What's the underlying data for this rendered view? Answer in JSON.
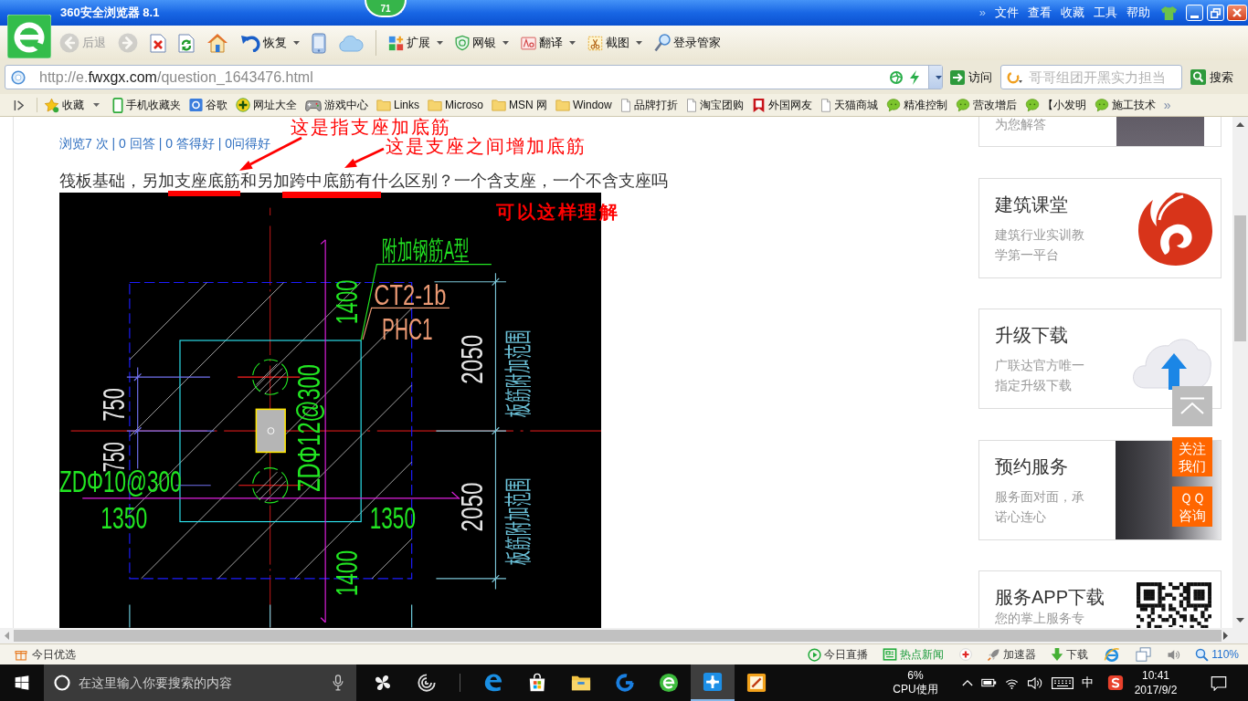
{
  "title_bar": {
    "title": "360安全浏览器 8.1",
    "badge": "71",
    "more": "»",
    "menu": [
      "文件",
      "查看",
      "收藏",
      "工具",
      "帮助"
    ]
  },
  "toolbar": {
    "nav": [
      {
        "kind": "back",
        "label": "后退",
        "disabled": true,
        "dropdown": false
      },
      {
        "kind": "forward",
        "disabled": true,
        "dropdown": false
      },
      {
        "kind": "stop",
        "disabled": false,
        "dropdown": false
      },
      {
        "kind": "refresh",
        "disabled": false,
        "dropdown": false
      },
      {
        "kind": "home",
        "disabled": false,
        "dropdown": false
      },
      {
        "kind": "restore",
        "label": "恢复",
        "disabled": false,
        "dropdown": true
      },
      {
        "kind": "phone",
        "disabled": false,
        "dropdown": false
      },
      {
        "kind": "cloud",
        "disabled": false,
        "dropdown": false
      }
    ],
    "tools": [
      {
        "kind": "extensions",
        "label": "扩展",
        "dropdown": true
      },
      {
        "kind": "bank",
        "label": "网银",
        "dropdown": true
      },
      {
        "kind": "translate",
        "label": "翻译",
        "dropdown": true
      },
      {
        "kind": "screenshot",
        "label": "截图",
        "dropdown": true
      },
      {
        "kind": "login",
        "label": "登录管家",
        "dropdown": false
      }
    ]
  },
  "address_bar": {
    "url": {
      "start": "http://e.",
      "domain": "fwxgx.com",
      "path": "/question_1643476.html"
    },
    "go_button": "访问",
    "search": {
      "placeholder": "哥哥组团开黑实力担当",
      "button": "搜索"
    }
  },
  "bookmarks": {
    "items": [
      {
        "kind": "star",
        "label": "收藏",
        "dropdown": true
      },
      {
        "kind": "mobile",
        "label": "手机收藏夹",
        "dropdown": false
      },
      {
        "kind": "tile",
        "label": "谷歌",
        "dropdown": false
      },
      {
        "kind": "plus",
        "label": "网址大全",
        "dropdown": false
      },
      {
        "kind": "gamepad",
        "label": "游戏中心",
        "dropdown": false
      },
      {
        "kind": "folder",
        "label": "Links",
        "dropdown": false
      },
      {
        "kind": "folder",
        "label": "Microso",
        "dropdown": false
      },
      {
        "kind": "folder",
        "label": "MSN 网",
        "dropdown": false
      },
      {
        "kind": "folder",
        "label": "Window",
        "dropdown": false
      },
      {
        "kind": "page",
        "label": "品牌打折",
        "dropdown": false
      },
      {
        "kind": "page",
        "label": "淘宝团购",
        "dropdown": false
      },
      {
        "kind": "flag",
        "label": "外国网友",
        "dropdown": false
      },
      {
        "kind": "page",
        "label": "天猫商城",
        "dropdown": false
      },
      {
        "kind": "chat",
        "label": "精准控制",
        "dropdown": false
      },
      {
        "kind": "chat",
        "label": "营改增后",
        "dropdown": false
      },
      {
        "kind": "chat",
        "label": "【小发明",
        "dropdown": false
      },
      {
        "kind": "chat",
        "label": "施工技术",
        "dropdown": false
      }
    ],
    "more": "»"
  },
  "page": {
    "stats": "浏览7 次 | 0 回答 | 0 答得好 | 0问得好",
    "question": "筏板基础，另加支座底筋和另加跨中底筋有什么区别？一个含支座，一个不含支座吗",
    "annotations": [
      {
        "kind": "callout",
        "text": "这是指支座加底筋"
      },
      {
        "kind": "callout",
        "text": "这是支座之间增加底筋"
      },
      {
        "kind": "note",
        "text": "可以这样理解"
      }
    ],
    "drawing": {
      "labels": [
        {
          "kind": "rebar",
          "text": "附加钢筋A型"
        },
        {
          "kind": "rebar",
          "text": "1400"
        },
        {
          "kind": "pile",
          "text": "CT2-1b"
        },
        {
          "kind": "pile",
          "text": "PHC1"
        },
        {
          "kind": "dimension",
          "text": "2050"
        },
        {
          "kind": "range",
          "text": "板筋附加范围"
        },
        {
          "kind": "dimension",
          "text": "750"
        },
        {
          "kind": "rebar",
          "text": "ZDΦ12@300"
        },
        {
          "kind": "dimension",
          "text": "750"
        },
        {
          "kind": "rebar",
          "text": "ZDΦ10@300"
        },
        {
          "kind": "dimension",
          "text": "2050"
        },
        {
          "kind": "rebar",
          "text": "1350"
        },
        {
          "kind": "rebar",
          "text": "1350"
        },
        {
          "kind": "range",
          "text": "板筋附加范围"
        },
        {
          "kind": "rebar",
          "text": "1400"
        }
      ]
    }
  },
  "sidebar": {
    "cards": [
      {
        "kind": "person",
        "subtitle": "为您解答"
      },
      {
        "kind": "logo",
        "title": "建筑课堂",
        "subtitle": "建筑行业实训教学第一平台"
      },
      {
        "kind": "upload",
        "title": "升级下载",
        "subtitle": "广联达官方唯一指定升级下载"
      },
      {
        "kind": "photo",
        "title": "预约服务",
        "subtitle": "服务面对面，承诺心连心"
      },
      {
        "kind": "qr",
        "title": "服务APP下载",
        "subtitle": "您的掌上服务专"
      }
    ],
    "float_buttons": [
      {
        "kind": "top"
      },
      {
        "kind": "text",
        "lines": [
          "关注",
          "我们"
        ]
      },
      {
        "kind": "text",
        "lines": [
          "ＱＱ",
          "咨询"
        ]
      }
    ]
  },
  "status_bar": {
    "left": "今日优选",
    "items": [
      {
        "kind": "live",
        "label": "今日直播"
      },
      {
        "kind": "news",
        "label": "热点新闻"
      },
      {
        "kind": "medkit"
      },
      {
        "kind": "rocket",
        "label": "加速器"
      },
      {
        "kind": "download",
        "label": "下载"
      },
      {
        "kind": "ie"
      },
      {
        "kind": "windows"
      },
      {
        "kind": "speaker"
      },
      {
        "kind": "zoom",
        "label": "110%"
      }
    ]
  },
  "taskbar": {
    "search_placeholder": "在这里输入你要搜索的内容",
    "apps": [
      {
        "kind": "pinwheel",
        "selected": false
      },
      {
        "kind": "swirl",
        "selected": false
      },
      {
        "kind": "edge",
        "selected": false
      },
      {
        "kind": "store",
        "selected": false
      },
      {
        "kind": "explorer",
        "selected": false
      },
      {
        "kind": "ring",
        "selected": false
      },
      {
        "kind": "browser",
        "selected": false
      },
      {
        "kind": "app",
        "selected": true
      },
      {
        "kind": "notes",
        "selected": false
      }
    ],
    "cpu": {
      "value": "6%",
      "label": "CPU使用"
    },
    "tray": [
      {
        "kind": "chevron"
      },
      {
        "kind": "battery"
      },
      {
        "kind": "wifi"
      },
      {
        "kind": "volume"
      },
      {
        "kind": "keyboard"
      },
      {
        "kind": "ime",
        "label": "中"
      },
      {
        "kind": "sogou"
      }
    ],
    "time": "10:41",
    "date": "2017/9/2"
  }
}
